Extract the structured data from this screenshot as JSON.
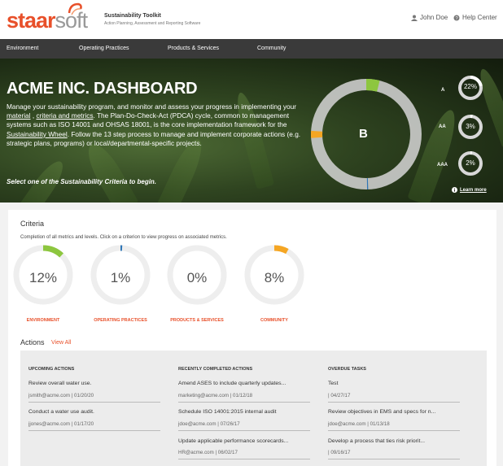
{
  "brand": {
    "logo_a": "staar",
    "logo_b": "soft",
    "toolkit": "Sustainability Toolkit",
    "tagline": "Action Planning, Assessment and Reporting Software"
  },
  "header": {
    "user": "John Doe",
    "help": "Help Center"
  },
  "nav": [
    "Environment",
    "Operating Practices",
    "Products & Services",
    "Community"
  ],
  "hero": {
    "title": "ACME INC. DASHBOARD",
    "p1": "Manage your sustainability program, and monitor and assess your progress in implementing your ",
    "link1": "material",
    "p2": " , ",
    "link2": "criteria and metrics",
    "p3": ". The Plan-Do-Check-Act (PDCA) cycle, common to management systems such as ISO 14001 and OHSAS 18001, is the core implementation framework for the ",
    "link3": "Sustainability Wheel",
    "p4": ". Follow the 13 step process to manage and implement corporate actions (e.g. strategic plans, programs) or local/departmental-specific projects.",
    "select": "Select one of the Sustainability Criteria to begin.",
    "grade": "B",
    "levels": [
      {
        "label": "A",
        "value": "22%",
        "fraction": 0.22
      },
      {
        "label": "AA",
        "value": "3%",
        "fraction": 0.03
      },
      {
        "label": "AAA",
        "value": "2%",
        "fraction": 0.02
      }
    ],
    "learn": "Learn more",
    "colors": {
      "environment": "#8dc63f",
      "operating": "#2e75b6",
      "community": "#f5a623"
    }
  },
  "criteria": {
    "title": "Criteria",
    "subtitle": "Completion of all metrics and levels. Click on a criterion to view progress on associated metrics.",
    "items": [
      {
        "label": "ENVIRONMENT",
        "value": "12%",
        "fraction": 0.12,
        "color": "#8dc63f"
      },
      {
        "label": "OPERATING PRACTICES",
        "value": "1%",
        "fraction": 0.01,
        "color": "#2e75b6"
      },
      {
        "label": "PRODUCTS & SERVICES",
        "value": "0%",
        "fraction": 0,
        "color": "#cccccc"
      },
      {
        "label": "COMMUNITY",
        "value": "8%",
        "fraction": 0.08,
        "color": "#f5a623"
      }
    ]
  },
  "actions": {
    "title": "Actions",
    "view_all": "View All",
    "columns": [
      {
        "header": "UPCOMING ACTIONS",
        "items": [
          {
            "title": "Review overall water use.",
            "meta": "jsmith@acme.com | 01/20/20"
          },
          {
            "title": "Conduct a water use audit.",
            "meta": "jjones@acme.com | 01/17/20"
          }
        ]
      },
      {
        "header": "RECENTLY COMPLETED ACTIONS",
        "items": [
          {
            "title": "Amend ASES to include quarterly updates...",
            "meta": "marketing@acme.com | 01/12/18"
          },
          {
            "title": "Schedule ISO 14001:2015 internal audit",
            "meta": "jdoe@acme.com | 07/26/17"
          },
          {
            "title": "Update applicable performance scorecards...",
            "meta": "HR@acme.com | 06/02/17"
          }
        ]
      },
      {
        "header": "OVERDUE TASKS",
        "items": [
          {
            "title": "Test",
            "meta": "| 04/27/17"
          },
          {
            "title": "Review objectives in EMS and specs for n...",
            "meta": "jdoe@acme.com | 01/13/18"
          },
          {
            "title": "Develop a process that ties risk priorit...",
            "meta": "| 09/16/17"
          }
        ]
      }
    ]
  }
}
